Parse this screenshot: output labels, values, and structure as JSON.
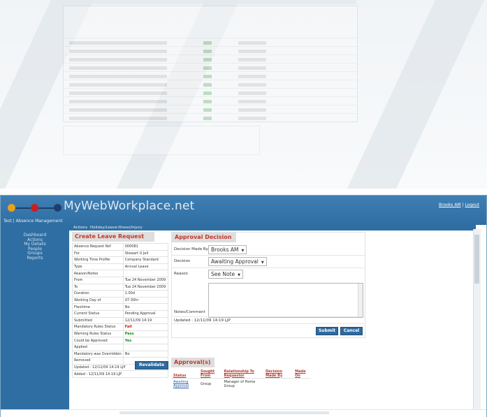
{
  "brand": {
    "name": "MyWebWorkplace.net",
    "subtitle": "Test | Absence Management",
    "logo_colors": [
      "#e8a21a",
      "#c82020",
      "#1e3f6e"
    ]
  },
  "user": {
    "name_link": "Brooks AM",
    "separator": " | ",
    "logout": "Logout"
  },
  "sidebar": {
    "items": [
      "Dashboard",
      "Actions",
      "My Details",
      "People",
      "Groups",
      "Reports"
    ]
  },
  "tabs": [
    "Actions",
    "Holiday/Leave",
    "Illness/Injury"
  ],
  "leave": {
    "title": "Create Leave Request",
    "rows": [
      {
        "k": "Absence Request Ref",
        "v": "000081",
        "s": ""
      },
      {
        "k": "For",
        "v": "Stewart U Jell",
        "s": ""
      },
      {
        "k": "Working Time Profile",
        "v": "Company Standard",
        "s": ""
      },
      {
        "k": "Type",
        "v": "Annual Leave",
        "s": ""
      },
      {
        "k": "Reason/Notes",
        "v": "",
        "s": ""
      },
      {
        "k": "From",
        "v": "Tue 24 November 2009",
        "s": ""
      },
      {
        "k": "To",
        "v": "Tue 24 November 2009",
        "s": ""
      },
      {
        "k": "Duration",
        "v": "1.00d",
        "s": ""
      },
      {
        "k": "Working Day of",
        "v": "07:30hr",
        "s": ""
      },
      {
        "k": "Flexitime",
        "v": "No",
        "s": ""
      },
      {
        "k": "Current Status",
        "v": "Pending Approval",
        "s": ""
      },
      {
        "k": "Submitted",
        "v": "12/11/09 14:19",
        "s": ""
      },
      {
        "k": "Mandatory Rules Status",
        "v": "Fail",
        "s": "fail"
      },
      {
        "k": "Warning Rules Status",
        "v": "Pass",
        "s": "pass"
      },
      {
        "k": "Could be Approved",
        "v": "Yes",
        "s": "pass"
      },
      {
        "k": "Applied",
        "v": "",
        "s": ""
      },
      {
        "k": "Mandatory was Overridden",
        "v": "No",
        "s": ""
      },
      {
        "k": "Removed",
        "v": "",
        "s": ""
      }
    ],
    "updated": "Updated : 12/11/09 14:19 LJP",
    "added": "Added : 12/11/09 14:19 LJP",
    "revalidate": "Revalidate"
  },
  "decision": {
    "title": "Approval Decision",
    "made_by_label": "Decision Made By",
    "made_by_value": "Brooks AM",
    "decision_label": "Decision",
    "decision_value": "Awaiting Approval",
    "reason_label": "Reason",
    "reason_value": "See Note",
    "notes_label": "Notes/Comment",
    "updated": "Updated : 12/11/09 14:19 LJP",
    "submit": "Submit",
    "cancel": "Cancel"
  },
  "approvals": {
    "title": "Approval(s)",
    "headers": [
      "Status",
      "Sought From",
      "Relationship To Requestor",
      "Decision Made By",
      "Made On"
    ],
    "rows": [
      [
        "Awaiting Approval",
        "Group",
        "Manager of Home Group",
        "",
        ""
      ]
    ]
  }
}
